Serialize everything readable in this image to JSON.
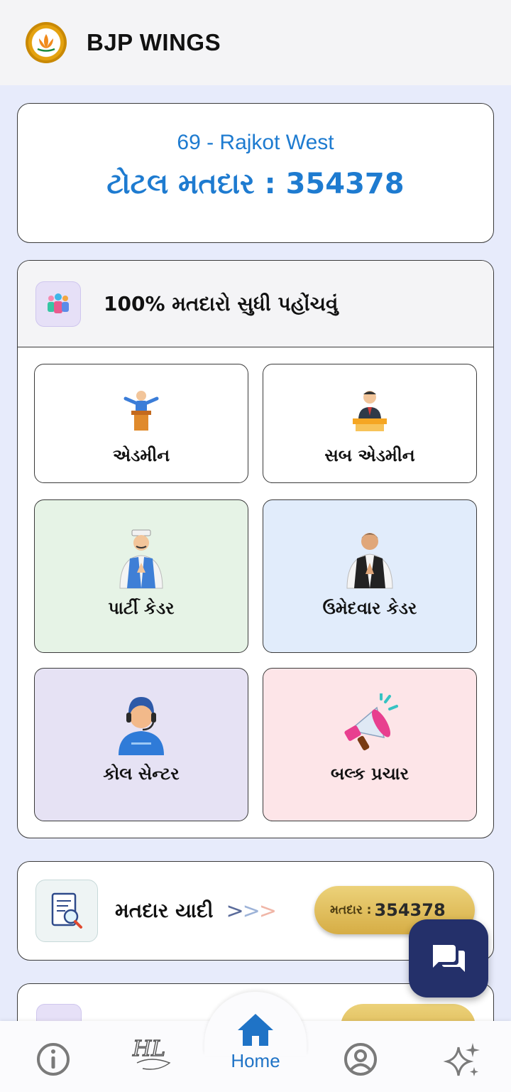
{
  "app": {
    "title": "BJP WINGS",
    "logo_icon": "bjp-lotus-logo"
  },
  "summary": {
    "constituency": "69 - Rajkot West",
    "total_voters_label": "ટોટલ મતદાર : 354378"
  },
  "reach_section": {
    "title": "100% મતદારો સુધી પહોંચવું",
    "icon": "group-icon",
    "tiles": [
      {
        "label": "એડમીન",
        "icon": "speaker-podium-icon",
        "bg": "#ffffff"
      },
      {
        "label": "સબ એડમીન",
        "icon": "officer-desk-icon",
        "bg": "#ffffff"
      },
      {
        "label": "પાર્ટી કેડર",
        "icon": "party-worker-icon",
        "bg": "#e6f3e6"
      },
      {
        "label": "ઉમેદવાર કેડર",
        "icon": "candidate-namaste-icon",
        "bg": "#e1ecfb"
      },
      {
        "label": "કોલ સેન્ટર",
        "icon": "call-center-agent-icon",
        "bg": "#e6e2f4"
      },
      {
        "label": "બલ્ક પ્રચાર",
        "icon": "megaphone-icon",
        "bg": "#fde5e8"
      }
    ]
  },
  "voter_list": {
    "title": "મતદાર યાદી",
    "icon": "document-search-icon",
    "count_label": "મતદાર :",
    "count_value": "354378"
  },
  "fab": {
    "icon": "chat-icon"
  },
  "bottom_nav": {
    "items": [
      {
        "name": "info",
        "icon": "info-icon"
      },
      {
        "name": "brand",
        "icon": "hl-logo-icon"
      },
      {
        "name": "home",
        "icon": "home-icon",
        "label": "Home"
      },
      {
        "name": "profile",
        "icon": "profile-icon"
      },
      {
        "name": "sparkle",
        "icon": "sparkle-icon"
      }
    ]
  },
  "colors": {
    "accent": "#1e7bd0",
    "background": "#e7ebfb",
    "fab": "#24306a",
    "pill_gold": "#d6ad45"
  }
}
